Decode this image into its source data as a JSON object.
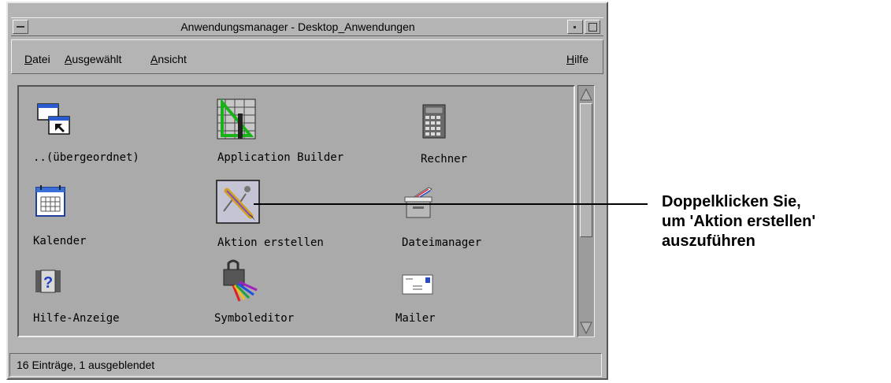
{
  "window": {
    "title": "Anwendungsmanager - Desktop_Anwendungen"
  },
  "menubar": {
    "items": [
      {
        "label": "Datei",
        "mnemonic": "D"
      },
      {
        "label": "Ausgewählt",
        "mnemonic": "A"
      },
      {
        "label": "Ansicht",
        "mnemonic": "A"
      }
    ],
    "help": {
      "label": "Hilfe",
      "mnemonic": "H"
    }
  },
  "icons": [
    {
      "label": "..(übergeordnet)",
      "icon": "folder-up-icon"
    },
    {
      "label": "Application Builder",
      "icon": "app-builder-icon"
    },
    {
      "label": "Rechner",
      "icon": "calculator-icon"
    },
    {
      "label": "Kalender",
      "icon": "calendar-icon"
    },
    {
      "label": "Aktion erstellen",
      "icon": "create-action-icon"
    },
    {
      "label": "Dateimanager",
      "icon": "file-manager-icon"
    },
    {
      "label": "Hilfe-Anzeige",
      "icon": "help-viewer-icon"
    },
    {
      "label": "Symboleditor",
      "icon": "icon-editor-icon"
    },
    {
      "label": "Mailer",
      "icon": "mailer-icon"
    }
  ],
  "status": {
    "text": "16 Einträge, 1 ausgeblendet"
  },
  "callout": {
    "lines": [
      "Doppelklicken Sie,",
      "um 'Aktion erstellen'",
      "auszuführen"
    ]
  }
}
